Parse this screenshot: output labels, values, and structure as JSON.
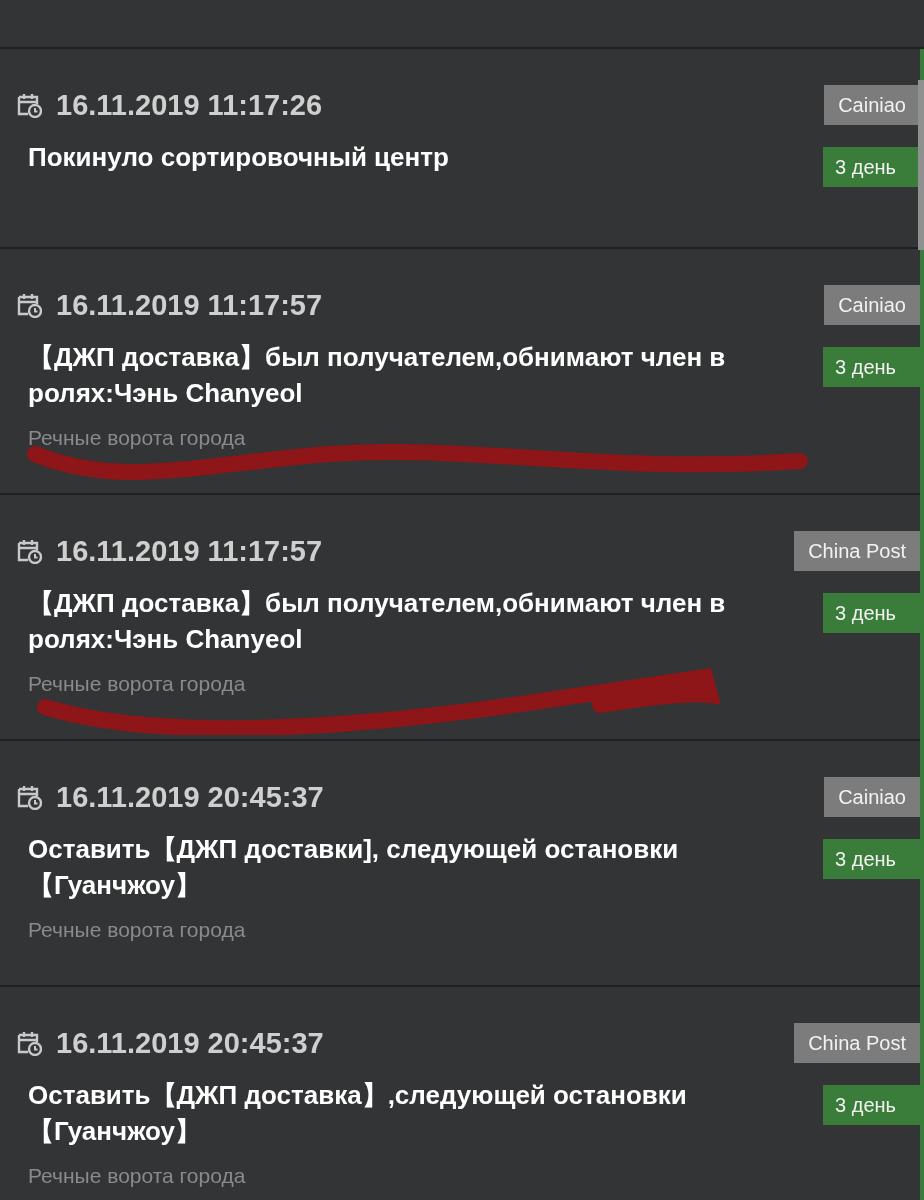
{
  "events": [
    {
      "time": "16.11.2019 11:17:26",
      "title": "Покинуло сортировочный центр",
      "carrier": "Cainiao",
      "days": "3 день",
      "scribbled": false
    },
    {
      "time": "16.11.2019 11:17:57",
      "title": "【ДЖП доставка】был получателем,обнимают член в ролях:Чэнь Chanyeol",
      "location": "Речные ворота города",
      "carrier": "Cainiao",
      "days": "3 день",
      "scribbled": true
    },
    {
      "time": "16.11.2019 11:17:57",
      "title": "【ДЖП доставка】был получателем,обнимают член в ролях:Чэнь Chanyeol",
      "location": "Речные ворота города",
      "carrier": "China Post",
      "days": "3 день",
      "scribbled": true
    },
    {
      "time": "16.11.2019 20:45:37",
      "title": "Оставить【ДЖП доставки], следующей остановки【Гуанчжоу】",
      "location": "Речные ворота города",
      "carrier": "Cainiao",
      "days": "3 день",
      "scribbled": false
    },
    {
      "time": "16.11.2019 20:45:37",
      "title": "Оставить【ДЖП доставка】,следующей остановки【Гуанчжоу】",
      "location": "Речные ворота города",
      "carrier": "China Post",
      "days": "3 день",
      "scribbled": false
    }
  ]
}
